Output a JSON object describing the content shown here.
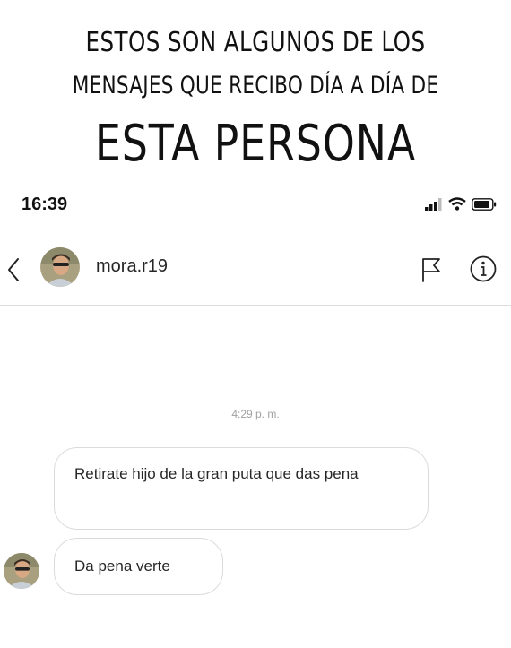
{
  "caption": {
    "line1": "ESTOS SON ALGUNOS DE LOS",
    "line2": "MENSAJES QUE RECIBO DÍA A DÍA DE",
    "line3": "ESTA PERSONA"
  },
  "status_bar": {
    "time": "16:39",
    "icons": [
      "signal-icon",
      "wifi-icon",
      "battery-icon"
    ]
  },
  "header": {
    "username": "mora.r19",
    "icons": [
      "back-icon",
      "avatar",
      "flag-icon",
      "info-icon"
    ]
  },
  "chat": {
    "timestamp": "4:29 p. m.",
    "messages": [
      {
        "text": "Retirate hijo de la gran puta que das pena"
      },
      {
        "text": "Da pena verte"
      }
    ]
  }
}
